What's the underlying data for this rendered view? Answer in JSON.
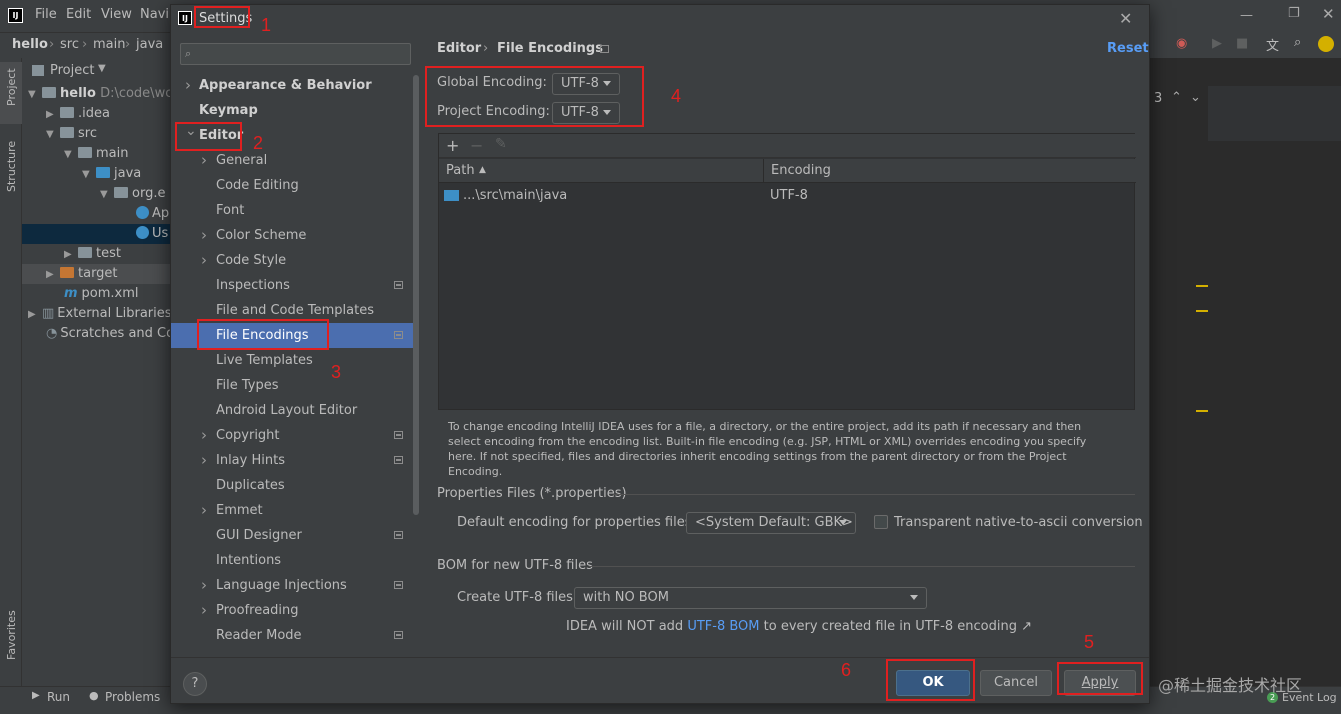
{
  "ide": {
    "menu": [
      "File",
      "Edit",
      "View",
      "Navi"
    ],
    "breadcrumb": [
      "hello",
      "src",
      "main",
      "java"
    ],
    "project_title": "Project",
    "left_tabs": [
      "Project",
      "Structure",
      "Favorites"
    ],
    "tree": [
      {
        "label": "hello",
        "extra": "D:\\code\\wc",
        "indent": 0
      },
      {
        "label": ".idea",
        "indent": 1
      },
      {
        "label": "src",
        "indent": 1
      },
      {
        "label": "main",
        "indent": 2
      },
      {
        "label": "java",
        "indent": 3
      },
      {
        "label": "org.e",
        "indent": 4
      },
      {
        "label": "Ap",
        "indent": 5
      },
      {
        "label": "Us",
        "indent": 5
      },
      {
        "label": "test",
        "indent": 2
      },
      {
        "label": "target",
        "indent": 1
      },
      {
        "label": "pom.xml",
        "indent": 1
      },
      {
        "label": "External Libraries",
        "indent": 0
      },
      {
        "label": "Scratches and Co",
        "indent": 0
      }
    ],
    "bottom": {
      "run": "Run",
      "problems": "Problems",
      "event_log": "Event Log",
      "event_count": "2"
    },
    "right_number": "3",
    "watermark": "@稀土掘金技术社区"
  },
  "dialog": {
    "title": "Settings",
    "close_icon": "close-icon",
    "nav": [
      {
        "label": "Appearance & Behavior",
        "bold": true,
        "chevron": ">",
        "indent": 0
      },
      {
        "label": "Keymap",
        "bold": true,
        "chevron": "",
        "indent": 0
      },
      {
        "label": "Editor",
        "bold": true,
        "chevron": "v",
        "indent": 0
      },
      {
        "label": "General",
        "chevron": ">",
        "indent": 1
      },
      {
        "label": "Code Editing",
        "chevron": "",
        "indent": 1
      },
      {
        "label": "Font",
        "chevron": "",
        "indent": 1
      },
      {
        "label": "Color Scheme",
        "chevron": ">",
        "indent": 1
      },
      {
        "label": "Code Style",
        "chevron": ">",
        "indent": 1
      },
      {
        "label": "Inspections",
        "chevron": "",
        "indent": 1,
        "page_icon": true
      },
      {
        "label": "File and Code Templates",
        "chevron": "",
        "indent": 1
      },
      {
        "label": "File Encodings",
        "chevron": "",
        "indent": 1,
        "page_icon": true,
        "selected": true
      },
      {
        "label": "Live Templates",
        "chevron": "",
        "indent": 1
      },
      {
        "label": "File Types",
        "chevron": "",
        "indent": 1
      },
      {
        "label": "Android Layout Editor",
        "chevron": "",
        "indent": 1
      },
      {
        "label": "Copyright",
        "chevron": ">",
        "indent": 1,
        "page_icon": true
      },
      {
        "label": "Inlay Hints",
        "chevron": ">",
        "indent": 1,
        "page_icon": true
      },
      {
        "label": "Duplicates",
        "chevron": "",
        "indent": 1
      },
      {
        "label": "Emmet",
        "chevron": ">",
        "indent": 1
      },
      {
        "label": "GUI Designer",
        "chevron": "",
        "indent": 1,
        "page_icon": true
      },
      {
        "label": "Intentions",
        "chevron": "",
        "indent": 1
      },
      {
        "label": "Language Injections",
        "chevron": ">",
        "indent": 1,
        "page_icon": true
      },
      {
        "label": "Proofreading",
        "chevron": ">",
        "indent": 1
      },
      {
        "label": "Reader Mode",
        "chevron": "",
        "indent": 1,
        "page_icon": true
      }
    ],
    "breadcrumb": {
      "parent": "Editor",
      "separator": "›",
      "page": "File Encodings"
    },
    "reset": "Reset",
    "global_encoding": {
      "label": "Global Encoding:",
      "value": "UTF-8"
    },
    "project_encoding": {
      "label": "Project Encoding:",
      "value": "UTF-8"
    },
    "table": {
      "toolbar": [
        "+",
        "−",
        "✎"
      ],
      "columns": [
        "Path",
        "Encoding"
      ],
      "sort_indicator": "▲",
      "rows": [
        {
          "path": "...\\src\\main\\java",
          "encoding": "UTF-8"
        }
      ]
    },
    "help": "To change encoding IntelliJ IDEA uses for a file, a directory, or the entire project, add its path if necessary and then select encoding from the encoding list. Built-in file encoding (e.g. JSP, HTML or XML) overrides encoding you specify here. If not specified, files and directories inherit encoding settings from the parent directory or from the Project Encoding.",
    "properties": {
      "title": "Properties Files (*.properties)",
      "default_label": "Default encoding for properties files:",
      "default_value": "<System Default: GBK>",
      "transparent_label": "Transparent native-to-ascii conversion",
      "transparent_checked": false
    },
    "bom": {
      "title": "BOM for new UTF-8 files",
      "create_label": "Create UTF-8 files:",
      "create_value": "with NO BOM",
      "note_prefix": "IDEA will NOT add ",
      "note_link": "UTF-8 BOM",
      "note_suffix": " to every created file in UTF-8 encoding ↗"
    },
    "buttons": {
      "help": "?",
      "ok": "OK",
      "cancel": "Cancel",
      "apply": "Apply"
    }
  },
  "annotations": [
    "1",
    "2",
    "3",
    "4",
    "5",
    "6"
  ],
  "colors": {
    "accent": "#4b6eaf",
    "link": "#589df6",
    "annotation": "#e02020",
    "ok_button": "#365880"
  }
}
